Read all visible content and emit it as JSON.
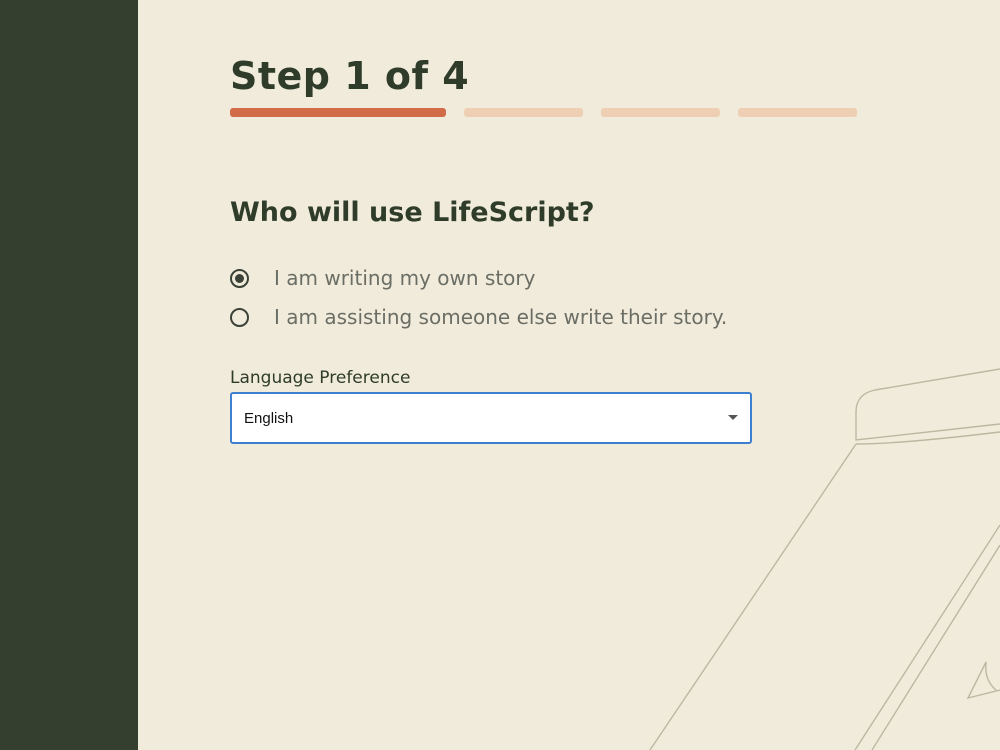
{
  "progress": {
    "title": "Step 1 of 4",
    "current_step": 1,
    "total_steps": 4,
    "active_color": "#d26c48",
    "inactive_color": "#efcfb4"
  },
  "form": {
    "question": "Who will use LifeScript?",
    "options": [
      {
        "label": "I am writing my own story",
        "selected": true
      },
      {
        "label": "I am assisting someone else write their story.",
        "selected": false
      }
    ],
    "language": {
      "label": "Language Preference",
      "value": "English"
    }
  },
  "theme": {
    "sidebar_color": "#353f30",
    "background_color": "#f1ebdb",
    "focus_color": "#3f7fd0"
  }
}
